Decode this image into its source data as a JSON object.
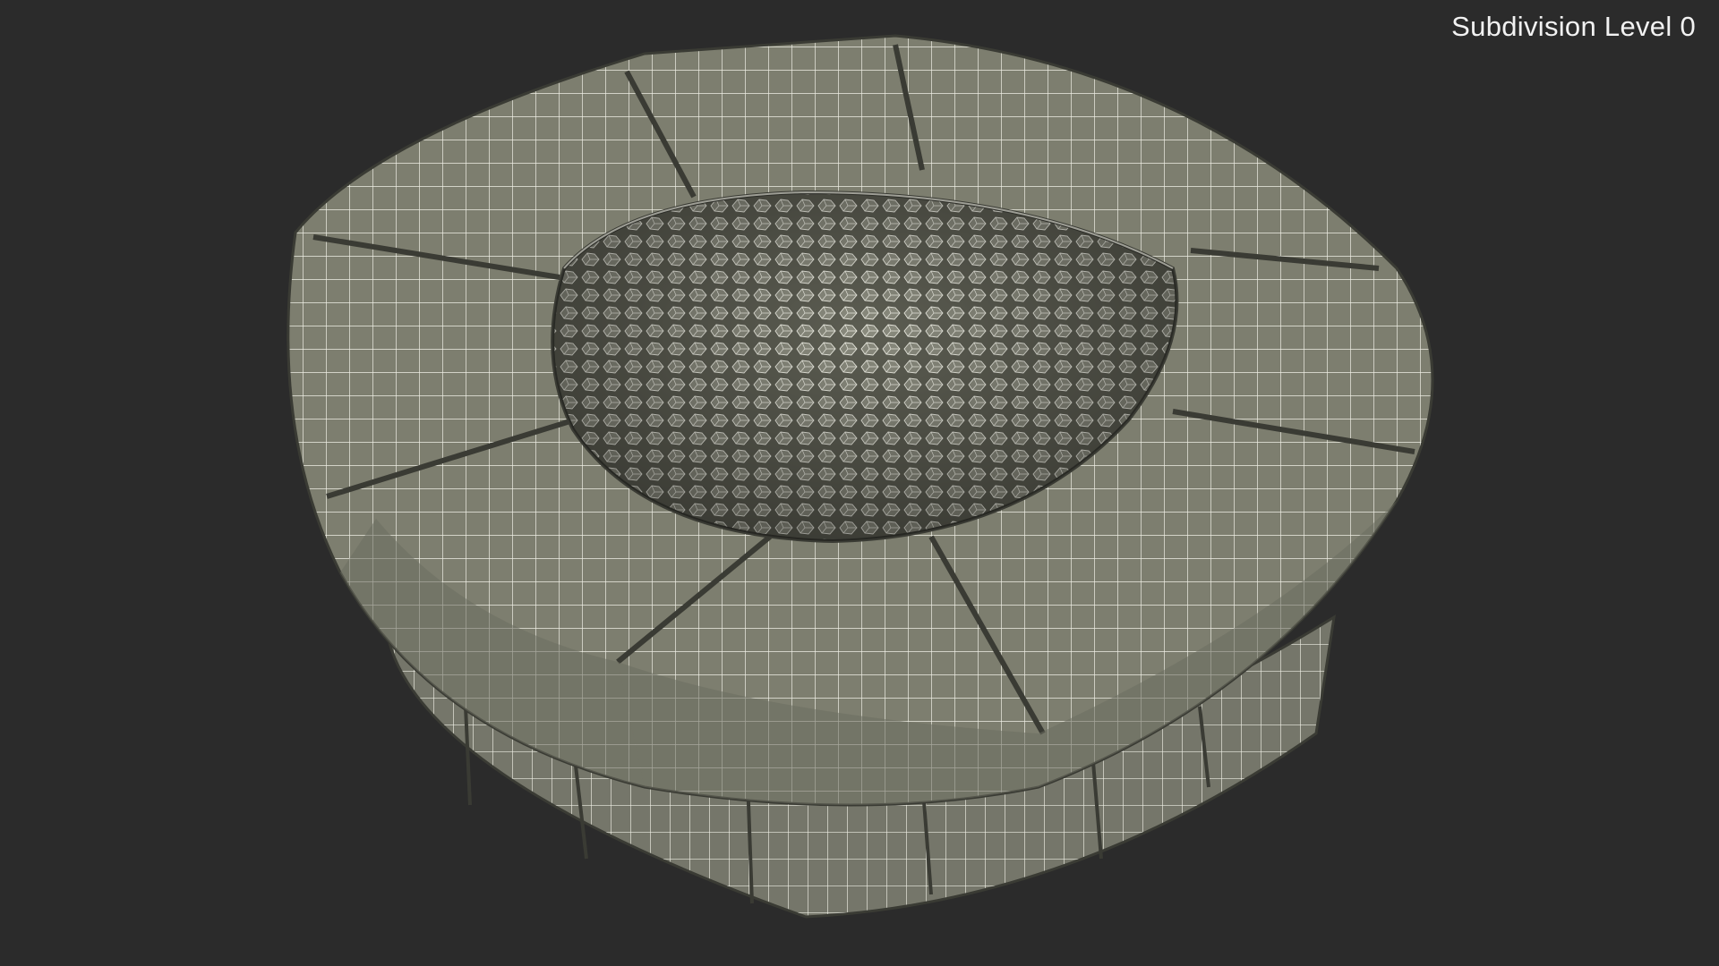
{
  "viewport": {
    "overlay_label": "Subdivision Level 0"
  },
  "model": {
    "subject": "fire-pit-wireframe",
    "colors": {
      "background": "#2b2b2b",
      "surface": "#7d7e6f",
      "surface_dark": "#5e5f53",
      "wire": "#f0f0e6",
      "seam": "#3a3b34"
    }
  }
}
